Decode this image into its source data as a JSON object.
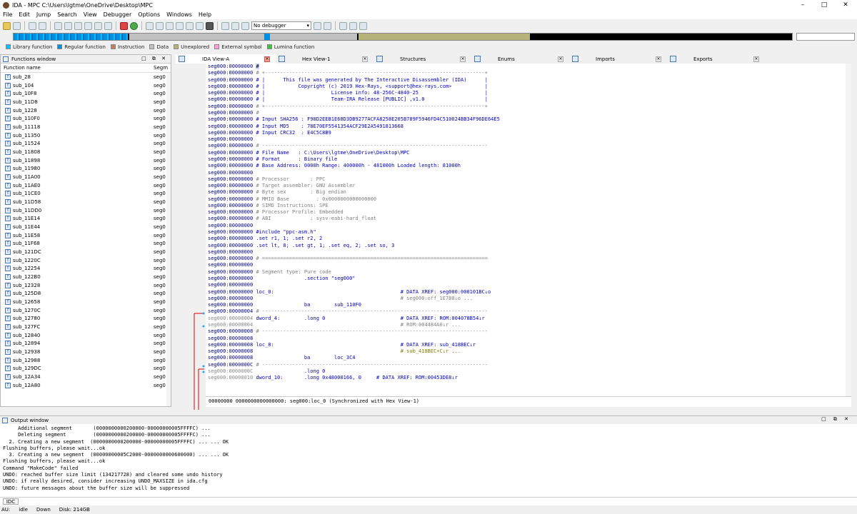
{
  "titlebar": {
    "title": "IDA - MPC C:\\Users\\lgtme\\OneDrive\\Desktop\\MPC"
  },
  "menu": [
    "File",
    "Edit",
    "Jump",
    "Search",
    "View",
    "Debugger",
    "Options",
    "Windows",
    "Help"
  ],
  "toolbar": {
    "debugger": "No debugger"
  },
  "legend": [
    {
      "label": "Library function",
      "color": "#00bfff"
    },
    {
      "label": "Regular function",
      "color": "#0090e0"
    },
    {
      "label": "Instruction",
      "color": "#c08060"
    },
    {
      "label": "Data",
      "color": "#c0c0c0"
    },
    {
      "label": "Unexplored",
      "color": "#b5b27a"
    },
    {
      "label": "External symbol",
      "color": "#ff9ed6"
    },
    {
      "label": "Lumina function",
      "color": "#40c040"
    }
  ],
  "functions_window": {
    "title": "Functions window",
    "col_name": "Function name",
    "col_seg": "Segm",
    "items": [
      "sub_28",
      "sub_104",
      "sub_10F8",
      "sub_11D8",
      "sub_1228",
      "sub_110F0",
      "sub_11118",
      "sub_11350",
      "sub_11524",
      "sub_11808",
      "sub_11898",
      "sub_11980",
      "sub_11A00",
      "sub_11AE0",
      "sub_11CE0",
      "sub_11D58",
      "sub_11DD0",
      "sub_11E14",
      "sub_11E44",
      "sub_11E58",
      "sub_11F68",
      "sub_121DC",
      "sub_1220C",
      "sub_12254",
      "sub_122B0",
      "sub_12328",
      "sub_125D8",
      "sub_12658",
      "sub_1270C",
      "sub_12780",
      "sub_127FC",
      "sub_12840",
      "sub_12894",
      "sub_12938",
      "sub_12988",
      "sub_129DC",
      "sub_12A34",
      "sub_12A80"
    ],
    "seg": "seg0"
  },
  "tabs": [
    {
      "label": "IDA View-A"
    },
    {
      "label": "Hex View-1"
    },
    {
      "label": "Structures"
    },
    {
      "label": "Enums"
    },
    {
      "label": "Imports"
    },
    {
      "label": "Exports"
    }
  ],
  "ida_view": {
    "lines": [
      {
        "a": "seg000:00000000",
        "t": "#",
        "k": "sel"
      },
      {
        "a": "seg000:00000000",
        "t": "# +-------------------------------------------------------------------------+",
        "k": "cm"
      },
      {
        "a": "seg000:00000000",
        "t": "# |      This file was generated by The Interactive Disassembler (IDA)      |",
        "k": "bl"
      },
      {
        "a": "seg000:00000000",
        "t": "# |           Copyright (c) 2019 Hex-Rays, <support@hex-rays.com>           |",
        "k": "bl"
      },
      {
        "a": "seg000:00000000",
        "t": "# |                      License info: 48-256C-4840-25                      |",
        "k": "bl"
      },
      {
        "a": "seg000:00000000",
        "t": "# |                      Team-IRA Release [PUBLIC] ,v1.0                    |",
        "k": "bl"
      },
      {
        "a": "seg000:00000000",
        "t": "# +-------------------------------------------------------------------------+",
        "k": "cm"
      },
      {
        "a": "seg000:00000000",
        "t": "#",
        "k": "cm"
      },
      {
        "a": "seg000:00000000",
        "t": "# Input SHA256 : F98D2EEB1E68D3DB9277ACFA8258E205B789F5946FD4C510024BB34F96DE64E5",
        "k": "bl"
      },
      {
        "a": "seg000:00000000",
        "t": "# Input MD5    : 78E70EF5541354ACF29E2A5491813668",
        "k": "bl"
      },
      {
        "a": "seg000:00000000",
        "t": "# Input CRC32  : E4C5C8B9",
        "k": "bl"
      },
      {
        "a": "seg000:00000000",
        "t": "",
        "k": ""
      },
      {
        "a": "seg000:00000000",
        "t": "# ---------------------------------------------------------------------------",
        "k": "cm"
      },
      {
        "a": "seg000:00000000",
        "t": "# File Name   : C:\\Users\\lgtme\\OneDrive\\Desktop\\MPC",
        "k": "bl"
      },
      {
        "a": "seg000:00000000",
        "t": "# Format      : Binary file",
        "k": "bl"
      },
      {
        "a": "seg000:00000000",
        "t": "# Base Address: 0000h Range: 400000h - 481000h Loaded length: 81000h",
        "k": "bl"
      },
      {
        "a": "seg000:00000000",
        "t": "",
        "k": ""
      },
      {
        "a": "seg000:00000000",
        "t": "# Processor       : PPC",
        "k": "cm"
      },
      {
        "a": "seg000:00000000",
        "t": "# Target assembler: GNU Assembler",
        "k": "cm"
      },
      {
        "a": "seg000:00000000",
        "t": "# Byte sex        : Big endian",
        "k": "cm"
      },
      {
        "a": "seg000:00000000",
        "t": "# MMIO Base         : 0x0000000000000000",
        "k": "cm"
      },
      {
        "a": "seg000:00000000",
        "t": "# SIMD Instructions: SPE",
        "k": "cm"
      },
      {
        "a": "seg000:00000000",
        "t": "# Processor Profile: Embedded",
        "k": "cm"
      },
      {
        "a": "seg000:00000000",
        "t": "# ABI             : sysv-eabi-hard_float",
        "k": "cm"
      },
      {
        "a": "seg000:00000000",
        "t": "",
        "k": ""
      },
      {
        "a": "seg000:00000000",
        "t": "#include \"ppc-asm.h\"",
        "k": "bl"
      },
      {
        "a": "seg000:00000000",
        "t": ".set r1, 1; .set r2, 2",
        "k": "bl"
      },
      {
        "a": "seg000:00000000",
        "t": ".set lt, 0; .set gt, 1; .set eq, 2; .set so, 3",
        "k": "bl"
      },
      {
        "a": "seg000:00000000",
        "t": "",
        "k": ""
      },
      {
        "a": "seg000:00000000",
        "t": "# ===========================================================================",
        "k": "cm"
      },
      {
        "a": "seg000:00000000",
        "t": "",
        "k": ""
      },
      {
        "a": "seg000:00000000",
        "t": "# Segment type: Pure code",
        "k": "cm"
      },
      {
        "a": "seg000:00000000",
        "t": "                .section \"seg000\"",
        "k": "bl"
      },
      {
        "a": "seg000:00000000",
        "t": "",
        "k": ""
      },
      {
        "a": "seg000:00000000",
        "t": "loc_0:                                          # DATA XREF: seg000:000101BC↓o",
        "k": "x"
      },
      {
        "a": "seg000:00000000",
        "t": "                                                # seg000:off_1E780↓o ...",
        "k": "xr"
      },
      {
        "a": "seg000:00000000",
        "t": "                ba        sub_110F0",
        "k": "bl"
      },
      {
        "a": "seg000:00000004",
        "t": "# ---------------------------------------------------------------------------",
        "k": "cm"
      },
      {
        "a": "seg000:00000004",
        "t": "dword_4:        .long 0                         # DATA XREF: ROM:004078B54↓r",
        "k": "xg"
      },
      {
        "a": "seg000:00000004",
        "t": "                                                # ROM:004484A0↓r ...",
        "k": "xrg"
      },
      {
        "a": "seg000:00000008",
        "t": "# ---------------------------------------------------------------------------",
        "k": "cm"
      },
      {
        "a": "seg000:00000008",
        "t": "",
        "k": ""
      },
      {
        "a": "seg000:00000008",
        "t": "loc_8:                                          # DATA XREF: sub_418BEC↓r",
        "k": "x"
      },
      {
        "a": "seg000:00000008",
        "t": "                                                # sub_418BEC+C↓r ...",
        "k": "hl"
      },
      {
        "a": "seg000:00000008",
        "t": "                ba        loc_3C4",
        "k": "bl"
      },
      {
        "a": "seg000:0000000C",
        "t": "# ---------------------------------------------------------------------------",
        "k": "cm"
      },
      {
        "a": "seg000:0000000C",
        "t": "                .long 0",
        "k": "g"
      },
      {
        "a": "seg000:00000010",
        "t": "dword_10:       .long 0x48000166, 0     # DATA XREF: ROM:00453DE8↓r",
        "k": "xg"
      }
    ],
    "status": "00000000 0000000000000000: seg000:loc_0 (Synchronized with Hex View-1)"
  },
  "output": {
    "title": "Output window",
    "lines": [
      "     Additional segment       (0000000000200000-00000000005FFFFC) ...",
      "     Deleting segment         (0000000000200000-00000000005FFFFC) ...",
      "  2. Creating a new segment  (0000000000200000-00000000005FFFFC) ... ... OK",
      "Flushing buffers, please wait...ok",
      "  3. Creating a new segment  (00000000005C2000-0000000000600000) ... ... OK",
      "Flushing buffers, please wait...ok",
      "Command \"MakeCode\" failed",
      "UNDO: reached buffer size limit (134217728) and cleared some undo history",
      "UNDO: if really desired, consider increasing UNDO_MAXSIZE in ida.cfg",
      "UNDO: future messages about the buffer size will be suppressed"
    ],
    "idc": "IDC"
  },
  "statusbar": {
    "au": "AU:",
    "state": "idle",
    "dir": "Down",
    "disk": "Disk: 214GB"
  }
}
